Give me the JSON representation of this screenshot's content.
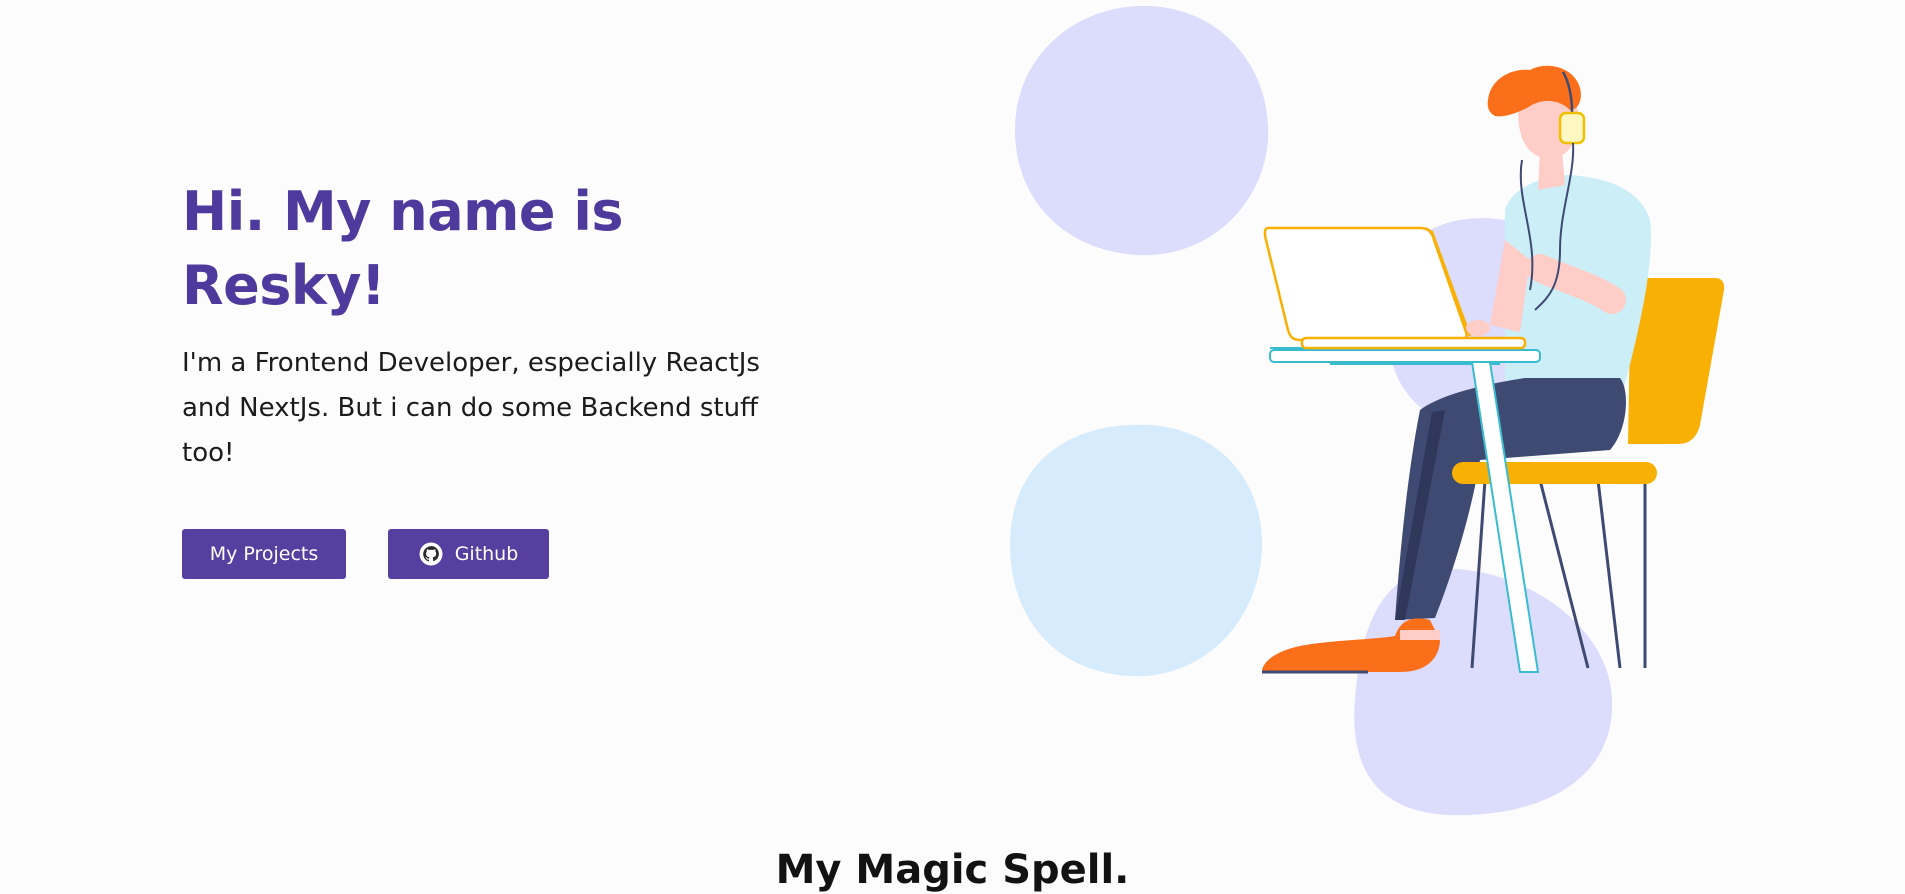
{
  "hero": {
    "title_line1": "Hi. My name is",
    "title_line2": "Resky!",
    "description": "I'm a Frontend Developer, especially ReactJs and NextJs. But i can do some Backend stuff too!",
    "buttons": {
      "projects_label": "My Projects",
      "github_label": "Github",
      "github_icon": "github-icon"
    }
  },
  "illustration": {
    "name": "developer-at-laptop-illustration",
    "blob_colors": [
      "#dcdcfd",
      "#d6ecfd"
    ],
    "accent_colors": [
      "#f8b005",
      "#fb6f1a",
      "#3f4a73",
      "#cceef7"
    ]
  },
  "section": {
    "title": "My Magic Spell."
  },
  "colors": {
    "brand": "#4e3a9c",
    "button": "#573f9f",
    "background": "#fdfcfd"
  }
}
